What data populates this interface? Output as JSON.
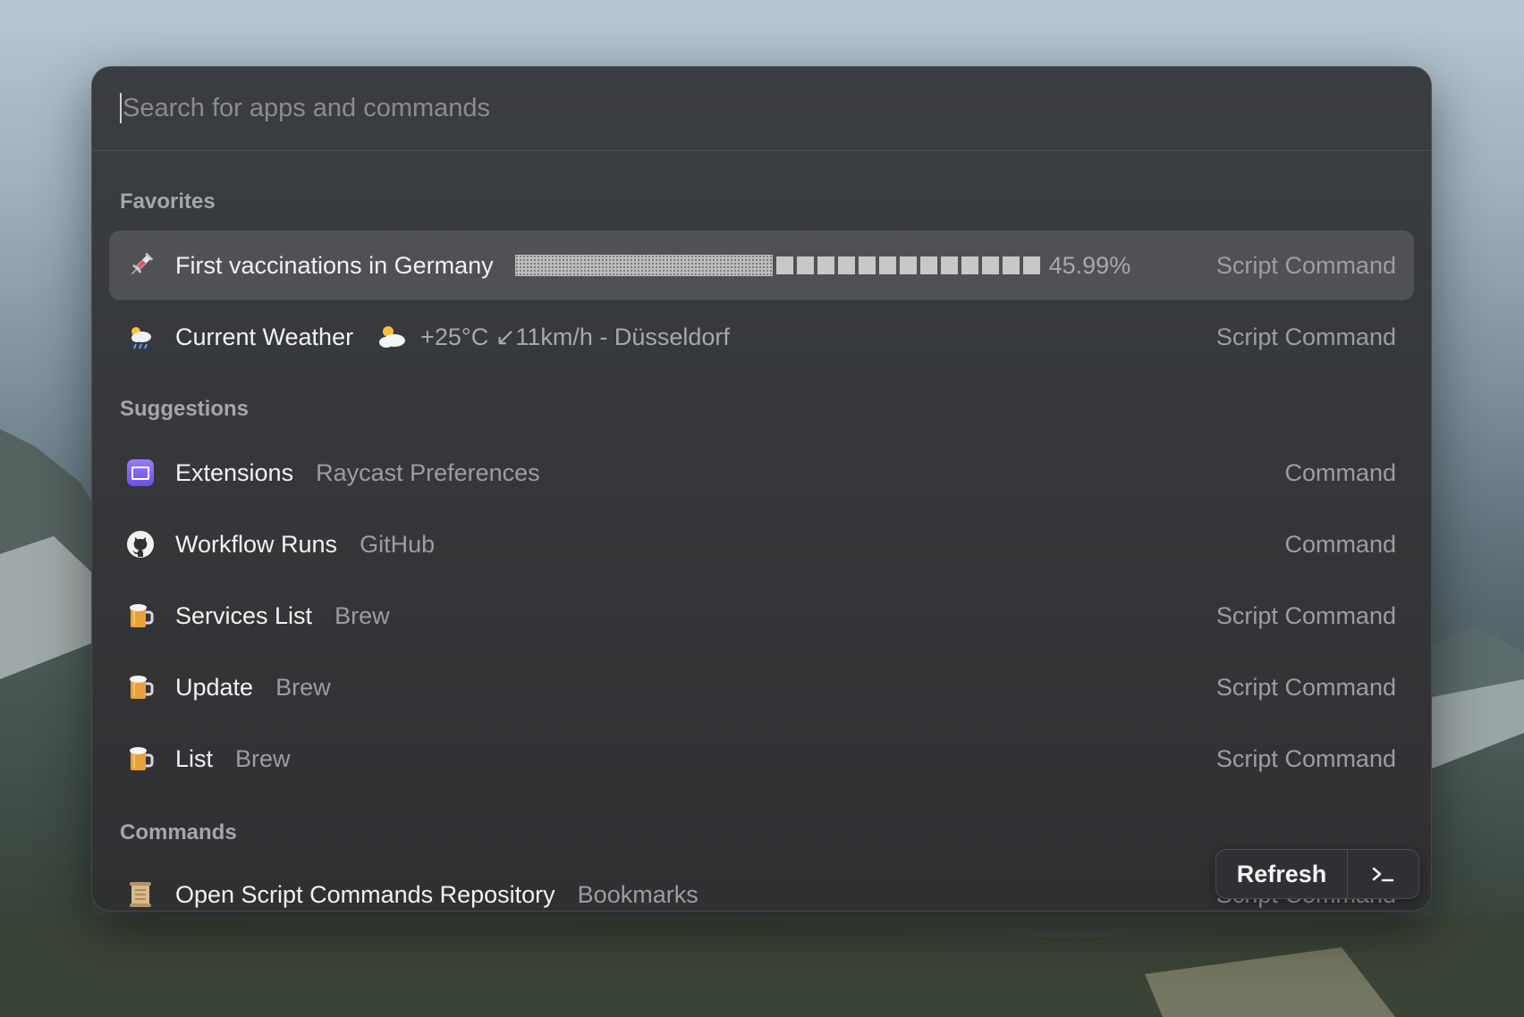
{
  "search": {
    "placeholder": "Search for apps and commands",
    "value": ""
  },
  "sections": {
    "favorites": "Favorites",
    "suggestions": "Suggestions",
    "commands": "Commands"
  },
  "favorites": [
    {
      "icon": "syringe-icon",
      "title": "First vaccinations in Germany",
      "progress_percent": 45.99,
      "progress_label": "45.99%",
      "type": "Script Command",
      "selected": true
    },
    {
      "icon": "weather-cloud-rain-icon",
      "title": "Current Weather",
      "accessory_icon": "sun-behind-cloud-icon",
      "accessory": "+25°C ↙11km/h - Düsseldorf",
      "type": "Script Command"
    }
  ],
  "suggestions": [
    {
      "icon": "extensions-icon",
      "title": "Extensions",
      "subtitle": "Raycast Preferences",
      "type": "Command"
    },
    {
      "icon": "github-icon",
      "title": "Workflow Runs",
      "subtitle": "GitHub",
      "type": "Command"
    },
    {
      "icon": "beer-mug-icon",
      "title": "Services List",
      "subtitle": "Brew",
      "type": "Script Command"
    },
    {
      "icon": "beer-mug-icon",
      "title": "Update",
      "subtitle": "Brew",
      "type": "Script Command"
    },
    {
      "icon": "beer-mug-icon",
      "title": "List",
      "subtitle": "Brew",
      "type": "Script Command"
    }
  ],
  "commands": [
    {
      "icon": "scroll-icon",
      "title": "Open Script Commands Repository",
      "subtitle": "Bookmarks",
      "type": "Script Command"
    }
  ],
  "action_bar": {
    "primary_label": "Refresh",
    "secondary_icon": "terminal-icon"
  }
}
